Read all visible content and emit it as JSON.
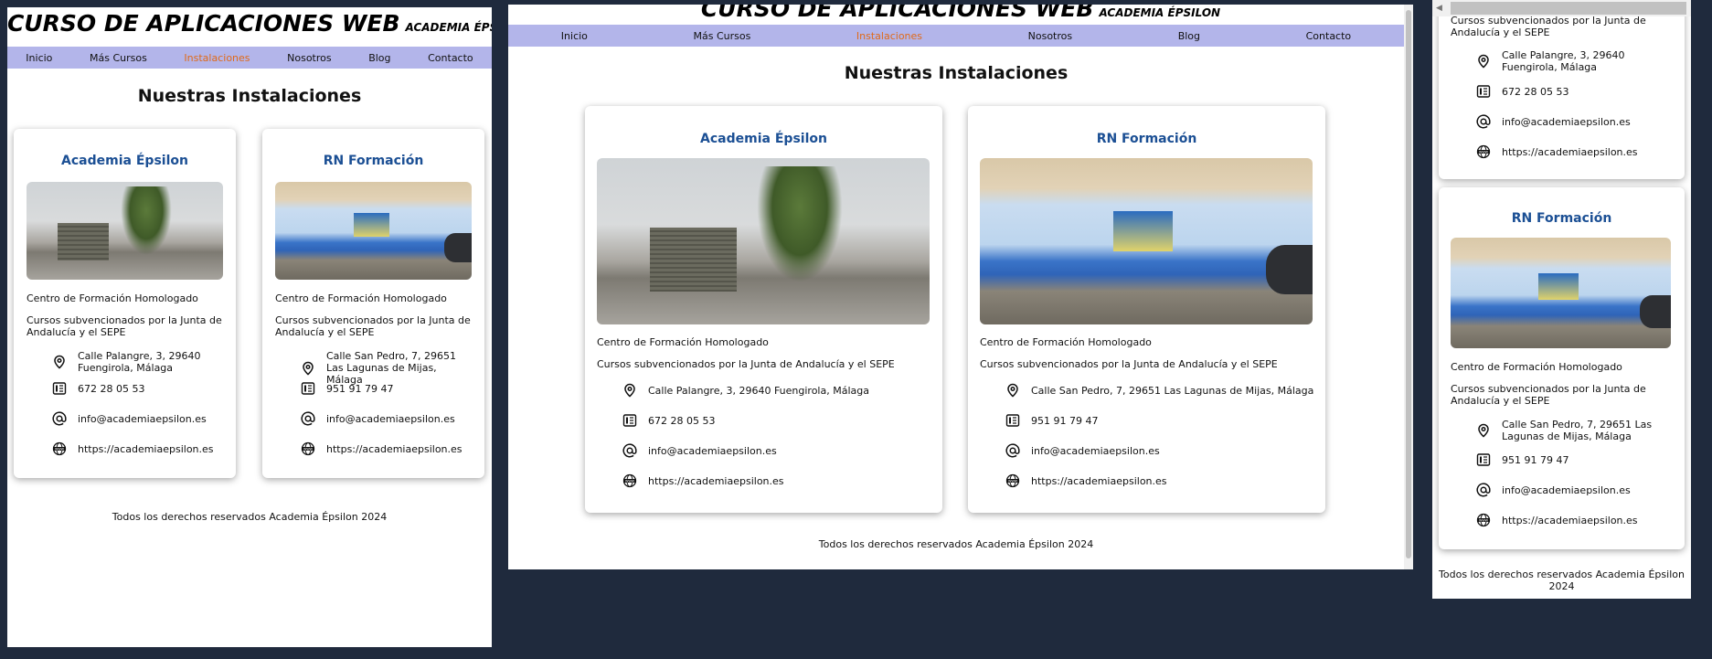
{
  "site": {
    "title": "CURSO DE APLICACIONES WEB",
    "subtitle": "ACADEMIA ÉPSILON",
    "nav": [
      "Inicio",
      "Más Cursos",
      "Instalaciones",
      "Nosotros",
      "Blog",
      "Contacto"
    ],
    "active_nav": "Instalaciones",
    "section_title": "Nuestras Instalaciones",
    "footer": "Todos los derechos reservados Academia Épsilon 2024"
  },
  "cards": [
    {
      "name": "Academia Épsilon",
      "line1": "Centro de Formación Homologado",
      "line2": "Cursos subvencionados por la Junta de Andalucía y el SEPE",
      "address": "Calle Palangre, 3, 29640 Fuengirola, Málaga",
      "phone": "672 28 05 53",
      "email": "info@academiaepsilon.es",
      "web": "https://academiaepsilon.es"
    },
    {
      "name": "RN Formación",
      "line1": "Centro de Formación Homologado",
      "line2": "Cursos subvencionados por la Junta de Andalucía y el SEPE",
      "address": "Calle San Pedro, 7, 29651 Las Lagunas de Mijas, Málaga",
      "phone": "951 91 79 47",
      "email": "info@academiaepsilon.es",
      "web": "https://academiaepsilon.es"
    }
  ],
  "colors": {
    "background": "#1f2a3d",
    "nav_bg": "#b3b5ea",
    "active_link": "#e06a1a",
    "card_title": "#1b4f94"
  }
}
